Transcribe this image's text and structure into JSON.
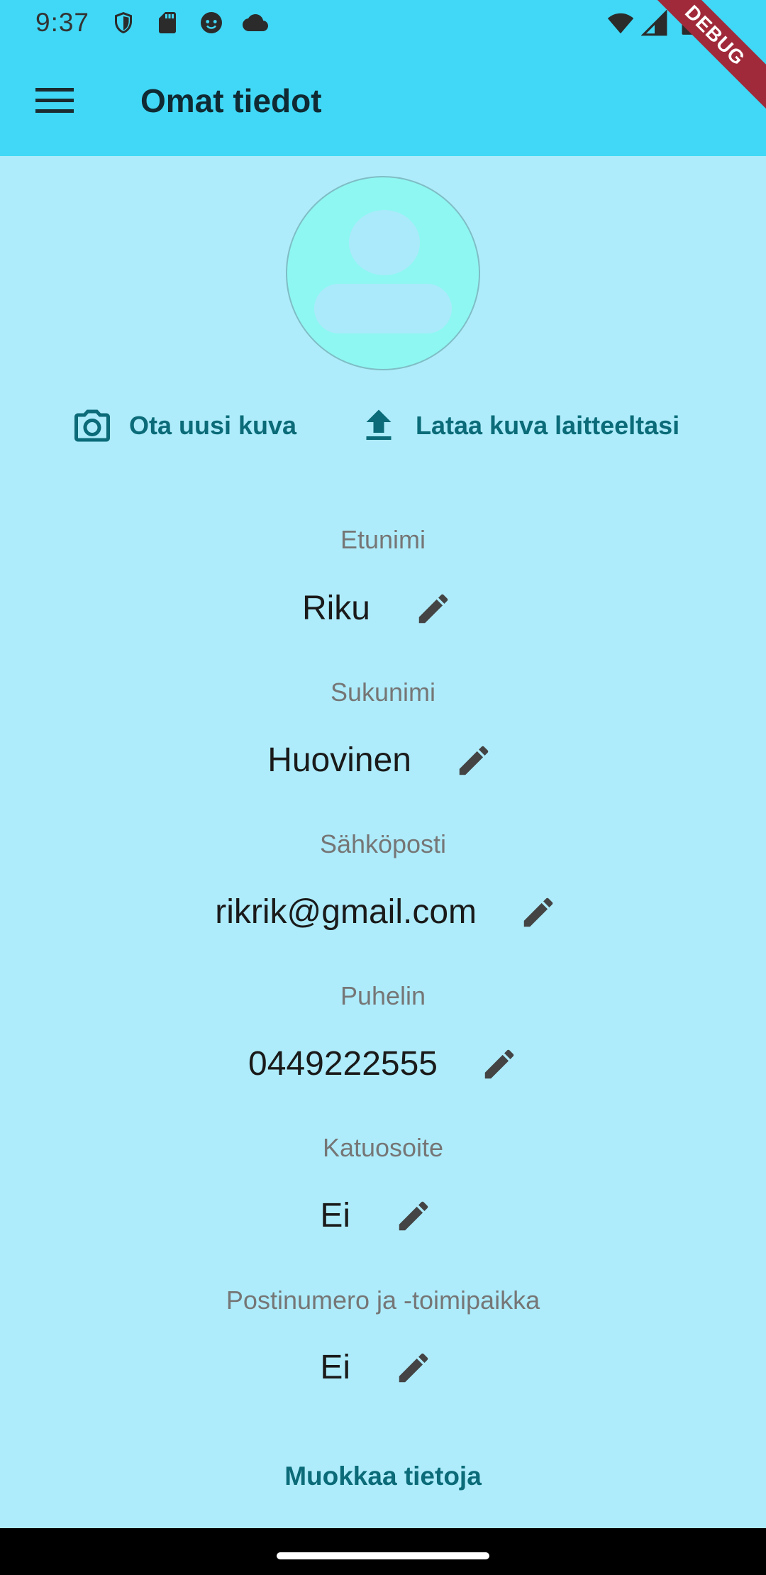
{
  "status_bar": {
    "time": "9:37",
    "left_icons": [
      "shield-icon",
      "sd-card-icon",
      "face-icon",
      "cloud-icon"
    ],
    "right_icons": [
      "wifi-icon",
      "signal-icon",
      "battery-icon"
    ]
  },
  "app_bar": {
    "title": "Omat tiedot",
    "menu_icon": "menu-icon",
    "debug_banner": "DEBUG",
    "color": "#40d8f6"
  },
  "photo_actions": {
    "take_photo": "Ota uusi kuva",
    "upload_photo": "Lataa kuva laitteeltasi"
  },
  "fields": [
    {
      "label": "Etunimi",
      "value": "Riku"
    },
    {
      "label": "Sukunimi",
      "value": "Huovinen"
    },
    {
      "label": "Sähköposti",
      "value": "rikrik@gmail.com"
    },
    {
      "label": "Puhelin",
      "value": "0449222555"
    },
    {
      "label": "Katuosoite",
      "value": "Ei"
    },
    {
      "label": "Postinumero ja -toimipaikka",
      "value": "Ei"
    }
  ],
  "edit_all": "Muokkaa tietoja",
  "colors": {
    "background": "#aeecfb",
    "accent": "#0b6b78"
  }
}
